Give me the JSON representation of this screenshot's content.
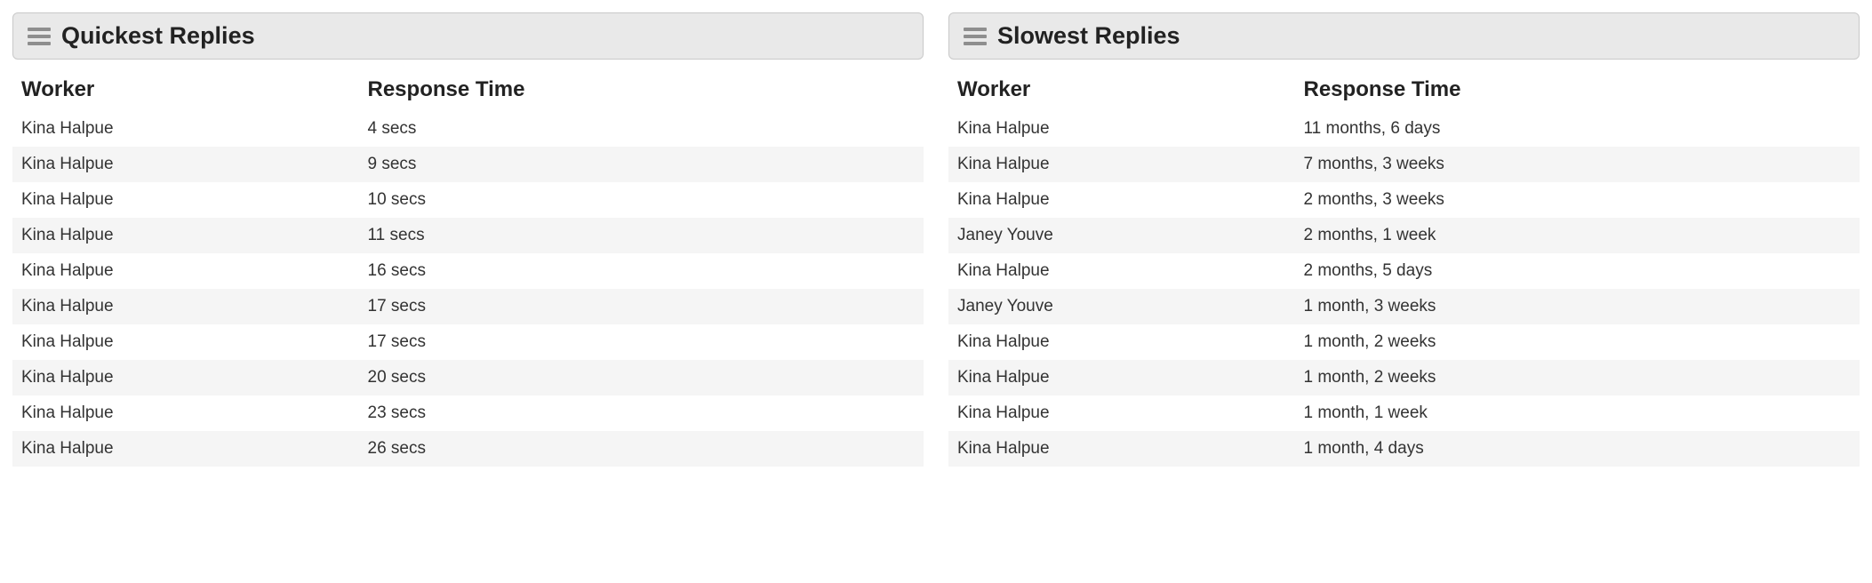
{
  "chart_data": {
    "type": "table",
    "quickest": {
      "title": "Quickest Replies",
      "columns": {
        "worker": "Worker",
        "time": "Response Time"
      },
      "rows": [
        {
          "worker": "Kina Halpue",
          "time": "4 secs"
        },
        {
          "worker": "Kina Halpue",
          "time": "9 secs"
        },
        {
          "worker": "Kina Halpue",
          "time": "10 secs"
        },
        {
          "worker": "Kina Halpue",
          "time": "11 secs"
        },
        {
          "worker": "Kina Halpue",
          "time": "16 secs"
        },
        {
          "worker": "Kina Halpue",
          "time": "17 secs"
        },
        {
          "worker": "Kina Halpue",
          "time": "17 secs"
        },
        {
          "worker": "Kina Halpue",
          "time": "20 secs"
        },
        {
          "worker": "Kina Halpue",
          "time": "23 secs"
        },
        {
          "worker": "Kina Halpue",
          "time": "26 secs"
        }
      ]
    },
    "slowest": {
      "title": "Slowest Replies",
      "columns": {
        "worker": "Worker",
        "time": "Response Time"
      },
      "rows": [
        {
          "worker": "Kina Halpue",
          "time": "11 months, 6 days"
        },
        {
          "worker": "Kina Halpue",
          "time": "7 months, 3 weeks"
        },
        {
          "worker": "Kina Halpue",
          "time": "2 months, 3 weeks"
        },
        {
          "worker": "Janey Youve",
          "time": "2 months, 1 week"
        },
        {
          "worker": "Kina Halpue",
          "time": "2 months, 5 days"
        },
        {
          "worker": "Janey Youve",
          "time": "1 month, 3 weeks"
        },
        {
          "worker": "Kina Halpue",
          "time": "1 month, 2 weeks"
        },
        {
          "worker": "Kina Halpue",
          "time": "1 month, 2 weeks"
        },
        {
          "worker": "Kina Halpue",
          "time": "1 month, 1 week"
        },
        {
          "worker": "Kina Halpue",
          "time": "1 month, 4 days"
        }
      ]
    }
  }
}
